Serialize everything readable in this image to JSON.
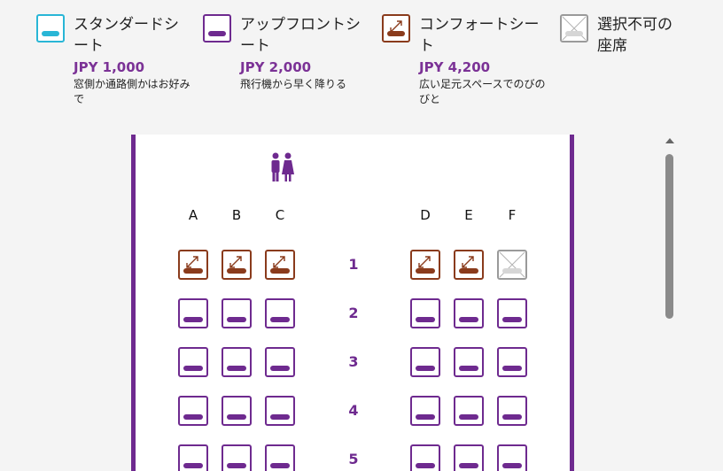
{
  "legend": [
    {
      "type": "standard",
      "name": "スタンダードシート",
      "price": "JPY 1,000",
      "desc": "窓側か通路側かはお好みで"
    },
    {
      "type": "upfront",
      "name": "アップフロントシート",
      "price": "JPY 2,000",
      "desc": "飛行機から早く降りる"
    },
    {
      "type": "comfort",
      "name": "コンフォートシート",
      "price": "JPY 4,200",
      "desc": "広い足元スペースでのびのびと"
    },
    {
      "type": "unavail",
      "name": "選択不可の座席",
      "price": "",
      "desc": ""
    }
  ],
  "columns": {
    "left": [
      "A",
      "B",
      "C"
    ],
    "right": [
      "D",
      "E",
      "F"
    ]
  },
  "rows": [
    {
      "number": "1",
      "seats": [
        "comfort",
        "comfort",
        "comfort",
        "comfort",
        "comfort",
        "unavail"
      ]
    },
    {
      "number": "2",
      "seats": [
        "upfront",
        "upfront",
        "upfront",
        "upfront",
        "upfront",
        "upfront"
      ]
    },
    {
      "number": "3",
      "seats": [
        "upfront",
        "upfront",
        "upfront",
        "upfront",
        "upfront",
        "upfront"
      ]
    },
    {
      "number": "4",
      "seats": [
        "upfront",
        "upfront",
        "upfront",
        "upfront",
        "upfront",
        "upfront"
      ]
    },
    {
      "number": "5",
      "seats": [
        "upfront",
        "upfront",
        "upfront",
        "upfront",
        "upfront",
        "upfront"
      ]
    }
  ],
  "colors": {
    "standard": "#29b6d6",
    "upfront": "#6e2a8f",
    "comfort": "#8a3b1c",
    "unavailable": "#9a9a9a",
    "cabin_wall": "#6e2a8f"
  },
  "icons": {
    "lavatory": "restroom-icon",
    "comfort": "expand-arrows-icon",
    "unavailable": "cross-icon"
  }
}
